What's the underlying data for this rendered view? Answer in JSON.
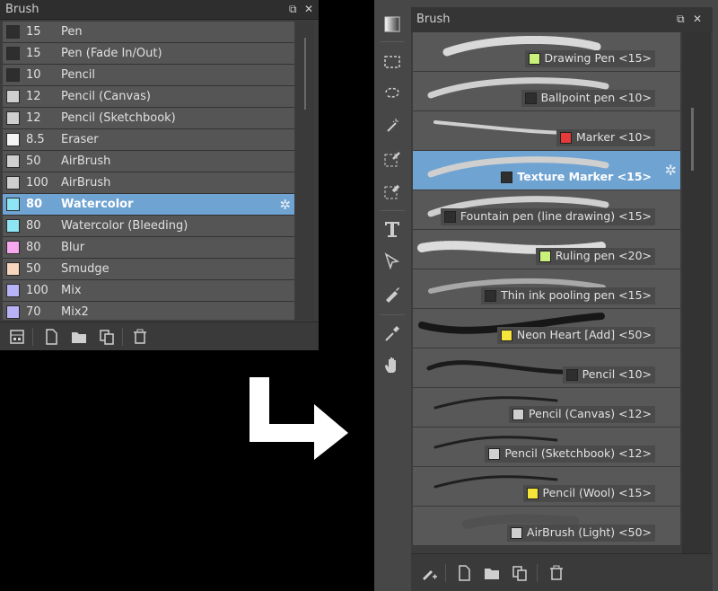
{
  "left_panel": {
    "title": "Brush",
    "float_glyph": "⧉",
    "close_glyph": "✕",
    "gear_glyph": "✲",
    "items": [
      {
        "size": "15",
        "name": "Pen",
        "color": "#2e2e2e",
        "selected": false
      },
      {
        "size": "15",
        "name": "Pen (Fade In/Out)",
        "color": "#2e2e2e",
        "selected": false
      },
      {
        "size": "10",
        "name": "Pencil",
        "color": "#2e2e2e",
        "selected": false
      },
      {
        "size": "12",
        "name": "Pencil (Canvas)",
        "color": "#cfcfcf",
        "selected": false
      },
      {
        "size": "12",
        "name": "Pencil (Sketchbook)",
        "color": "#cfcfcf",
        "selected": false
      },
      {
        "size": "8.5",
        "name": "Eraser",
        "color": "#f4f4f4",
        "selected": false
      },
      {
        "size": "50",
        "name": "AirBrush",
        "color": "#cfcfcf",
        "selected": false
      },
      {
        "size": "100",
        "name": "AirBrush",
        "color": "#cfcfcf",
        "selected": false
      },
      {
        "size": "80",
        "name": "Watercolor",
        "color": "#8ee6f5",
        "selected": true
      },
      {
        "size": "80",
        "name": "Watercolor (Bleeding)",
        "color": "#8ee6f5",
        "selected": false
      },
      {
        "size": "80",
        "name": "Blur",
        "color": "#f7a7ee",
        "selected": false
      },
      {
        "size": "50",
        "name": "Smudge",
        "color": "#f7d6bd",
        "selected": false
      },
      {
        "size": "100",
        "name": "Mix",
        "color": "#b8b3f7",
        "selected": false
      },
      {
        "size": "70",
        "name": "Mix2",
        "color": "#b8b3f7",
        "selected": false
      }
    ],
    "toolbar": [
      "brush-settings-icon",
      "new-brush-icon",
      "new-folder-icon",
      "duplicate-icon",
      "delete-icon"
    ]
  },
  "right_panel": {
    "title": "Brush",
    "float_glyph": "⧉",
    "close_glyph": "✕",
    "gear_glyph": "✲",
    "vertical_tools": [
      "gradient-icon",
      "rect-select-icon",
      "lasso-select-icon",
      "magic-wand-icon",
      "select-pen-icon",
      "select-eraser-icon",
      "text-tool-icon",
      "object-select-icon",
      "brush-tool-icon",
      "eyedropper-icon",
      "hand-icon"
    ],
    "items": [
      {
        "label": "Drawing Pen <15>",
        "color": "#c8f07a",
        "stroke": "chalk-light",
        "selected": false
      },
      {
        "label": "Ballpoint pen <10>",
        "color": "#2e2e2e",
        "stroke": "soft-light",
        "selected": false
      },
      {
        "label": "Marker <10>",
        "color": "#e83a3a",
        "stroke": "thin-light",
        "selected": false
      },
      {
        "label": "Texture Marker <15>",
        "color": "#2e2e2e",
        "stroke": "soft-light",
        "selected": true
      },
      {
        "label": "Fountain pen (line drawing) <15>",
        "color": "#2e2e2e",
        "stroke": "soft-light",
        "selected": false
      },
      {
        "label": "Ruling pen <20>",
        "color": "#c8f07a",
        "stroke": "rough-light",
        "selected": false
      },
      {
        "label": "Thin ink pooling pen <15>",
        "color": "#2e2e2e",
        "stroke": "faint",
        "selected": false
      },
      {
        "label": "Neon Heart [Add] <50>",
        "color": "#f5e53a",
        "stroke": "blur-dark",
        "selected": false
      },
      {
        "label": "Pencil <10>",
        "color": "#2e2e2e",
        "stroke": "taper-dark",
        "selected": false
      },
      {
        "label": "Pencil (Canvas) <12>",
        "color": "#cfcfcf",
        "stroke": "rough-dark",
        "selected": false
      },
      {
        "label": "Pencil (Sketchbook) <12>",
        "color": "#cfcfcf",
        "stroke": "rough-dark",
        "selected": false
      },
      {
        "label": "Pencil (Wool) <15>",
        "color": "#f5e53a",
        "stroke": "rough-dark",
        "selected": false
      },
      {
        "label": "AirBrush (Light) <50>",
        "color": "#cfcfcf",
        "stroke": "air",
        "selected": false
      }
    ],
    "toolbar": [
      "brush-settings-icon",
      "new-brush-icon",
      "new-folder-icon",
      "duplicate-icon",
      "delete-icon"
    ]
  }
}
